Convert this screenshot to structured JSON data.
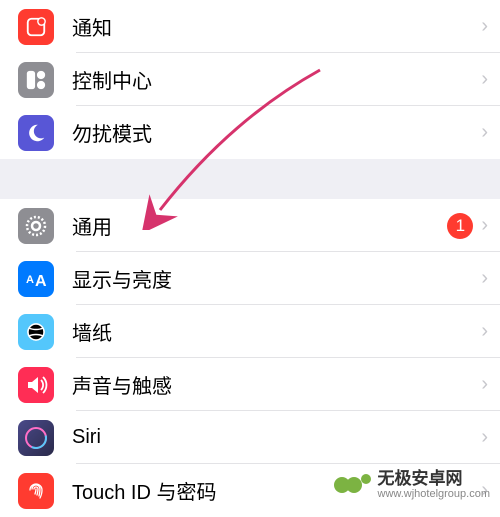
{
  "group1": [
    {
      "key": "notifications",
      "label": "通知",
      "icon": "notifications-icon",
      "bg": "#ff3b30"
    },
    {
      "key": "control-center",
      "label": "控制中心",
      "icon": "control-center-icon",
      "bg": "#8e8e93"
    },
    {
      "key": "do-not-disturb",
      "label": "勿扰模式",
      "icon": "dnd-icon",
      "bg": "#5856d6"
    }
  ],
  "group2": [
    {
      "key": "general",
      "label": "通用",
      "icon": "gear-icon",
      "bg": "#8e8e93",
      "badge": "1"
    },
    {
      "key": "display-brightness",
      "label": "显示与亮度",
      "icon": "display-icon",
      "bg": "#007aff"
    },
    {
      "key": "wallpaper",
      "label": "墙纸",
      "icon": "wallpaper-icon",
      "bg": "#54c7fc"
    },
    {
      "key": "sounds-haptics",
      "label": "声音与触感",
      "icon": "sounds-icon",
      "bg": "#ff2d55"
    },
    {
      "key": "siri",
      "label": "Siri",
      "icon": "siri-icon",
      "bg": "#000000"
    },
    {
      "key": "touch-id-passcode",
      "label": "Touch ID 与密码",
      "icon": "touchid-icon",
      "bg": "#ff3b30"
    }
  ],
  "watermark": {
    "title": "无极安卓网",
    "url": "www.wjhotelgroup.com"
  }
}
